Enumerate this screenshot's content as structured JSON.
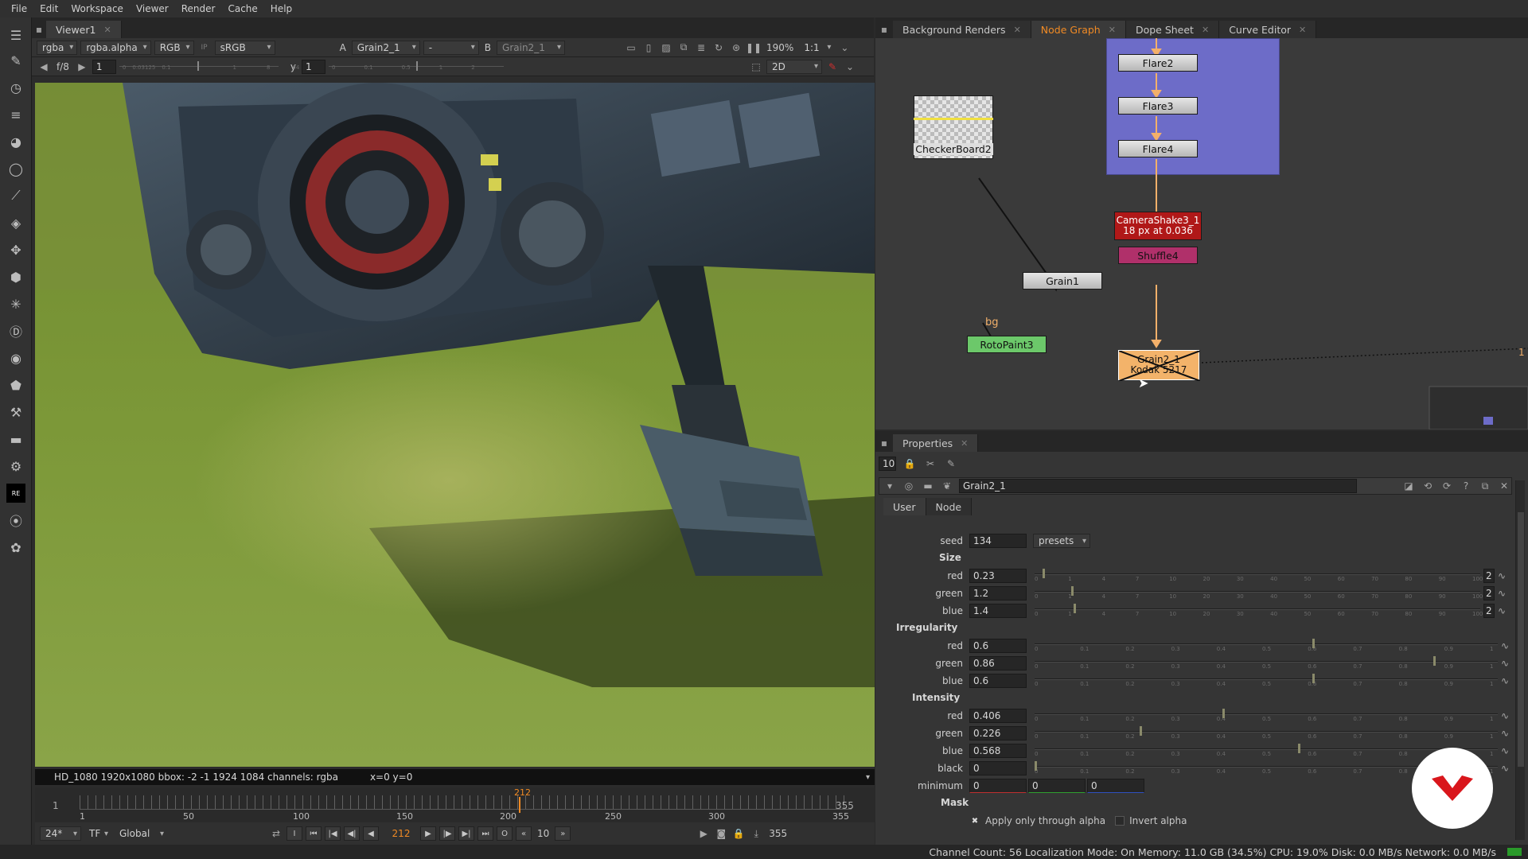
{
  "menu": [
    "File",
    "Edit",
    "Workspace",
    "Viewer",
    "Render",
    "Cache",
    "Help"
  ],
  "viewer": {
    "tab": "Viewer1",
    "channels": "rgba",
    "alpha": "rgba.alpha",
    "colorspace_mode": "RGB",
    "ip": "IP",
    "lut": "sRGB",
    "input_a_label": "A",
    "input_a": "Grain2_1",
    "wipe": "-",
    "input_b_label": "B",
    "input_b": "Grain2_1",
    "zoom": "190%",
    "ratio": "1:1",
    "fstop": "f/8",
    "gain_value": "1",
    "gamma_label": "y",
    "gamma_value": "1",
    "gain_ticks": [
      "0",
      "0.03125",
      "0.1",
      "1",
      "8",
      "64"
    ],
    "gamma_ticks": [
      "0",
      "0.1",
      "0.5",
      "1",
      "2"
    ],
    "view_mode": "2D",
    "info_format": "HD_1080 1920x1080  bbox: -2 -1 1924 1084 channels: rgba",
    "info_coords": "x=0 y=0",
    "timeline_start": "1",
    "timeline_end": "355",
    "timeline_labels": [
      "1",
      "50",
      "100",
      "150",
      "200",
      "250",
      "300",
      "355"
    ],
    "current_frame_marker": "212",
    "fps": "24*",
    "tf": "TF",
    "range_mode": "Global",
    "current_frame": "212",
    "step": "10",
    "end_frame": "355",
    "bottom_left_frame": "1"
  },
  "nodegraph": {
    "tabs": [
      {
        "label": "Background Renders",
        "active": false
      },
      {
        "label": "Node Graph",
        "active": true
      },
      {
        "label": "Dope Sheet",
        "active": false
      },
      {
        "label": "Curve Editor",
        "active": false
      }
    ],
    "nodes": {
      "flare2": "Flare2",
      "flare3": "Flare3",
      "flare4": "Flare4",
      "checkerboard": "CheckerBoard2",
      "camerashake_line1": "CameraShake3_1",
      "camerashake_line2": "18 px at 0.036",
      "shuffle": "Shuffle4",
      "grain1": "Grain1",
      "bg_label": "bg",
      "rotopaint": "RotoPaint3",
      "grain2_line1": "Grain2_1",
      "grain2_line2": "Kodak 5217",
      "edge_number": "1"
    }
  },
  "properties": {
    "tab": "Properties",
    "max_panels": "10",
    "node_name": "Grain2_1",
    "subtabs": [
      {
        "label": "User",
        "active": true
      },
      {
        "label": "Node",
        "active": false
      }
    ],
    "seed_label": "seed",
    "seed": "134",
    "presets": "presets",
    "size_section": "Size",
    "size_red": "0.23",
    "size_green": "1.2",
    "size_blue": "1.4",
    "size_ticks": [
      "0",
      "1",
      "4",
      "7",
      "10",
      "20",
      "30",
      "40",
      "50",
      "60",
      "70",
      "80",
      "90",
      "100"
    ],
    "irregularity_section": "Irregularity",
    "irr_red": "0.6",
    "irr_green": "0.86",
    "irr_blue": "0.6",
    "unit_ticks": [
      "0",
      "0.1",
      "0.2",
      "0.3",
      "0.4",
      "0.5",
      "0.6",
      "0.7",
      "0.8",
      "0.9",
      "1"
    ],
    "intensity_section": "Intensity",
    "int_red": "0.406",
    "int_green": "0.226",
    "int_blue": "0.568",
    "black": "0",
    "minimum_r": "0",
    "minimum_g": "0",
    "minimum_b": "0",
    "mask_section": "Mask",
    "apply_alpha": "Apply only through alpha",
    "invert_alpha": "Invert alpha",
    "red_label": "red",
    "green_label": "green",
    "blue_label": "blue",
    "black_label": "black",
    "minimum_label": "minimum",
    "dim_count": "2",
    "checkmark": "✖"
  },
  "status_bar": "Channel Count: 56  Localization Mode: On  Memory: 11.0 GB (34.5%)  CPU: 19.0%  Disk: 0.0 MB/s  Network: 0.0 MB/s",
  "colors": {
    "accent": "#f08a24",
    "backdrop": "#6d6cc8",
    "camerashake": "#b01818",
    "shuffle": "#b0306a",
    "rotopaint": "#6cc86a",
    "grain2": "#f3b36a",
    "pipe": "#f3b06a"
  }
}
